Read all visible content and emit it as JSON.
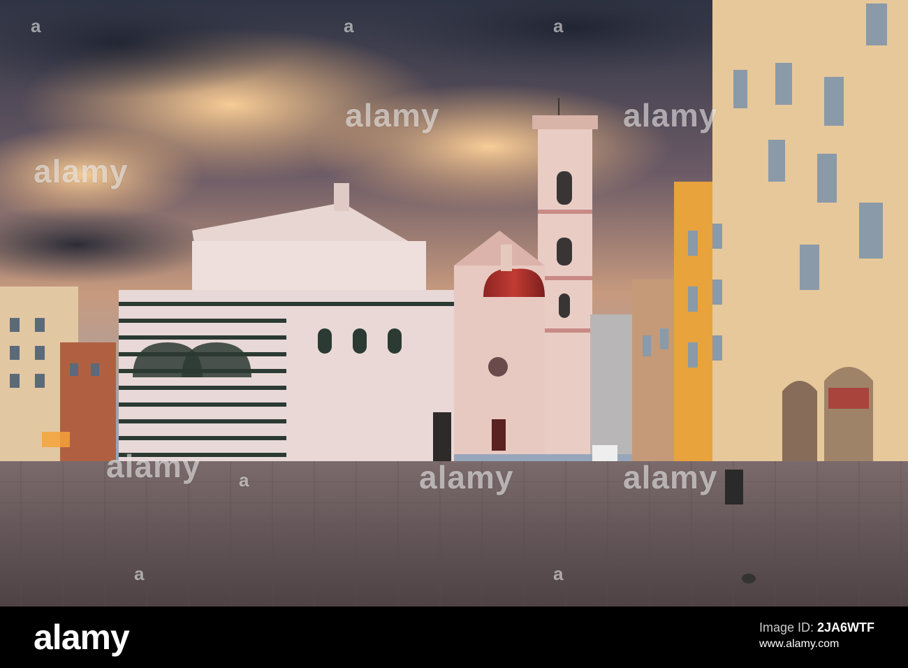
{
  "photo": {
    "subject": "",
    "palette": {
      "sky_dark": "#2f3444",
      "sky_glow": "#f3b576",
      "sky_blue": "#7c9cc4",
      "marble_white": "#e8d8d8",
      "marble_green": "#2b3a33",
      "dome_red": "#b8332c",
      "pavement": "#6c5a5c",
      "facade_orange": "#e8a33c",
      "facade_cream": "#e7c89a",
      "neon_red": "#ff2b2b"
    }
  },
  "watermarks": [
    {
      "text": "alamy"
    },
    {
      "text": "alamy"
    },
    {
      "text": "alamy"
    },
    {
      "text": "alamy"
    },
    {
      "text": "alamy"
    },
    {
      "text": "alamy"
    },
    {
      "text": "a"
    },
    {
      "text": "a"
    },
    {
      "text": "a"
    },
    {
      "text": "a"
    },
    {
      "text": "a"
    },
    {
      "text": "a"
    }
  ],
  "footer": {
    "logo": "alamy",
    "image_id_label": "Image ID: ",
    "image_id": "2JA6WTF",
    "site": "www.alamy.com"
  }
}
